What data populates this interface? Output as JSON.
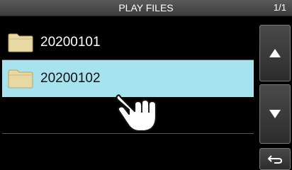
{
  "header": {
    "title": "PLAY FILES",
    "page": "1/1"
  },
  "files": [
    {
      "name": "20200101",
      "selected": false
    },
    {
      "name": "20200102",
      "selected": true
    }
  ],
  "icons": {
    "folder": "folder-icon",
    "up": "triangle-up-icon",
    "down": "triangle-down-icon",
    "back": "return-arrow-icon",
    "touch": "touch-hand-icon"
  },
  "colors": {
    "selected_row": "#a6e3ef",
    "folder": "#e8d9a4"
  }
}
